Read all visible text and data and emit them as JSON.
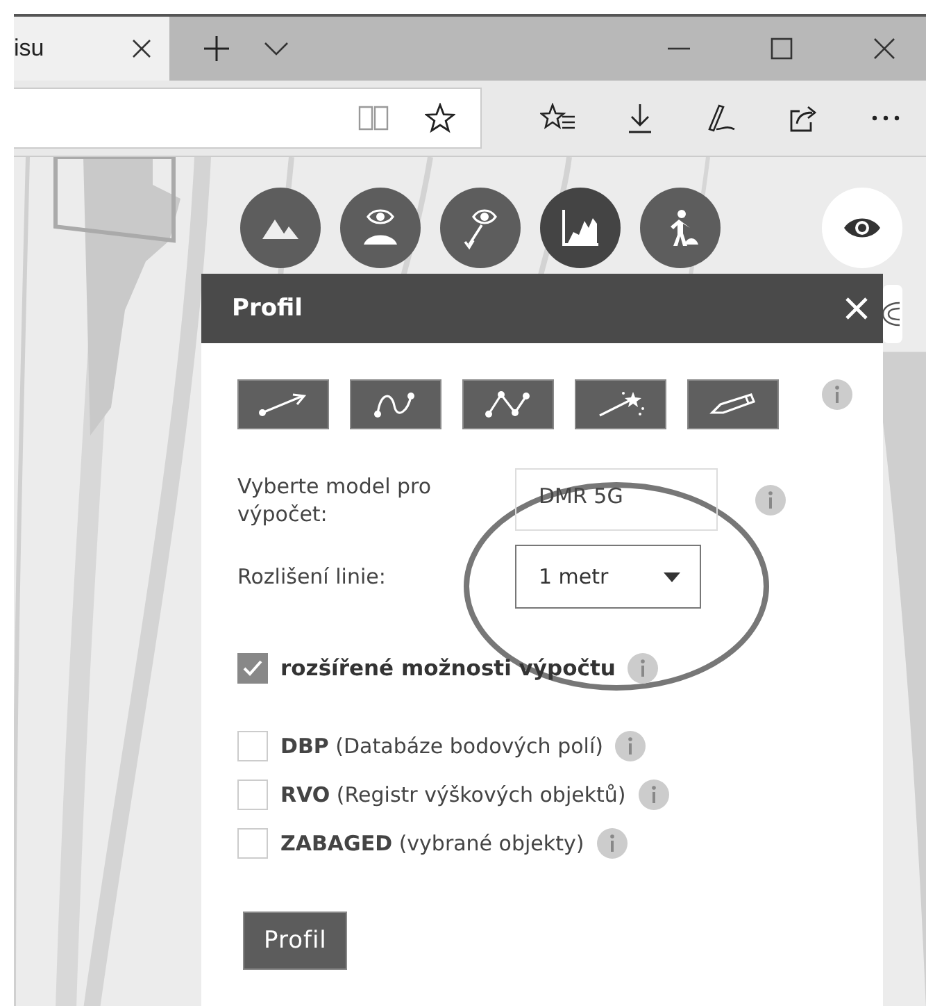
{
  "browser": {
    "tab_title": "isu"
  },
  "panel": {
    "title": "Profil",
    "model": {
      "label": "Vyberte model pro výpočet:",
      "value": "DMR 5G"
    },
    "resolution": {
      "label": "Rozlišení linie:",
      "value": "1 metr"
    },
    "advanced": {
      "label": "rozšířené možnosti výpočtu",
      "checked": true
    },
    "layers": [
      {
        "label": "**DBP** (Databáze bodových polí)",
        "checked": false
      },
      {
        "label": "**RVO** (Registr výškových objektů)",
        "checked": false
      },
      {
        "label": "**ZABAGED** (vybrané objekty)",
        "checked": false
      }
    ],
    "button": "Profil"
  }
}
